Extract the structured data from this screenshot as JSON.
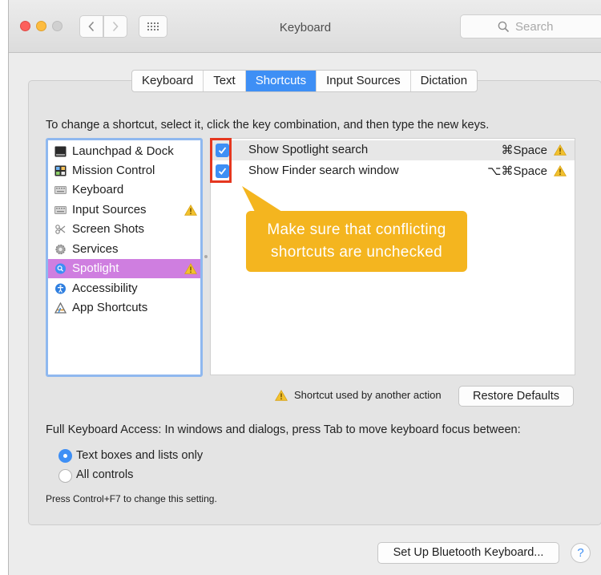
{
  "window": {
    "title": "Keyboard"
  },
  "search": {
    "placeholder": "Search"
  },
  "toolbar": {
    "icons": [
      "chevron-left-icon",
      "chevron-right-icon",
      "grid-icon"
    ]
  },
  "tabs": [
    {
      "label": "Keyboard",
      "active": false
    },
    {
      "label": "Text",
      "active": false
    },
    {
      "label": "Shortcuts",
      "active": true
    },
    {
      "label": "Input Sources",
      "active": false
    },
    {
      "label": "Dictation",
      "active": false
    }
  ],
  "instruction": "To change a shortcut, select it, click the key combination, and then type the new keys.",
  "sidebar": {
    "items": [
      {
        "label": "Launchpad & Dock",
        "icon": "launchpad-icon",
        "warning": false,
        "selected": false
      },
      {
        "label": "Mission Control",
        "icon": "mission-control-icon",
        "warning": false,
        "selected": false
      },
      {
        "label": "Keyboard",
        "icon": "keyboard-icon",
        "warning": false,
        "selected": false
      },
      {
        "label": "Input Sources",
        "icon": "input-sources-icon",
        "warning": true,
        "selected": false
      },
      {
        "label": "Screen Shots",
        "icon": "screenshot-icon",
        "warning": false,
        "selected": false
      },
      {
        "label": "Services",
        "icon": "gear-icon",
        "warning": false,
        "selected": false
      },
      {
        "label": "Spotlight",
        "icon": "spotlight-icon",
        "warning": true,
        "selected": true
      },
      {
        "label": "Accessibility",
        "icon": "accessibility-icon",
        "warning": false,
        "selected": false
      },
      {
        "label": "App Shortcuts",
        "icon": "app-shortcuts-icon",
        "warning": false,
        "selected": false
      }
    ]
  },
  "shortcuts": [
    {
      "label": "Show Spotlight search",
      "key": "⌘Space",
      "checked": true,
      "warning": true
    },
    {
      "label": "Show Finder search window",
      "key": "⌥⌘Space",
      "checked": true,
      "warning": true
    }
  ],
  "callout": {
    "line1": "Make sure that conflicting",
    "line2": "shortcuts are unchecked"
  },
  "legend": {
    "text": "Shortcut used by another action"
  },
  "buttons": {
    "restore": "Restore Defaults",
    "bluetooth": "Set Up Bluetooth Keyboard...",
    "help": "?"
  },
  "full_keyboard_access": {
    "label": "Full Keyboard Access: In windows and dialogs, press Tab to move keyboard focus between:",
    "options": [
      {
        "label": "Text boxes and lists only",
        "selected": true
      },
      {
        "label": "All controls",
        "selected": false
      }
    ],
    "hint": "Press Control+F7 to change this setting."
  },
  "colors": {
    "accent": "#3e8ff5",
    "selection": "#cf7ee0",
    "callout": "#f4b51f",
    "highlight": "#e5371f",
    "warning": "#f2c12e"
  }
}
